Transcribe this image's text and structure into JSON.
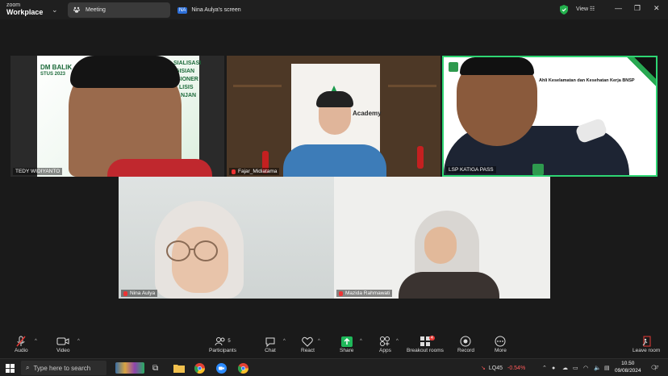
{
  "titlebar": {
    "brand_top": "zoom",
    "brand_bottom": "Workplace",
    "tab_meeting": "Meeting",
    "screen_initials": "NA",
    "tab_screen": "Nina Aulya's screen",
    "view_label": "View"
  },
  "participants": [
    {
      "name": "TEDY WIDIYANTO"
    },
    {
      "name": "Fajar_Midiatama"
    },
    {
      "name": "LSP KATIGA PASS"
    },
    {
      "name": "Nina Aulya"
    },
    {
      "name": "Mazida Rahmawati"
    }
  ],
  "tile_text": {
    "banner_left_1": "DM BALIK",
    "banner_left_2": "STUS 2023",
    "banner_right_1": "SIALISASI",
    "banner_right_2": "GISIAN",
    "banner_right_3": "SIONER",
    "banner_right_4": "LISIS",
    "banner_right_5": "NJAN",
    "academy_text": "Academy",
    "lsp_caption": "Ahli Keselamatan dan Kesehatan Kerja BNSP"
  },
  "toolbar": {
    "audio": "Audio",
    "video": "Video",
    "participants": "Participants",
    "participants_count": "5",
    "chat": "Chat",
    "react": "React",
    "share": "Share",
    "apps": "Apps",
    "breakout": "Breakout rooms",
    "breakout_badge": "4",
    "record": "Record",
    "more": "More",
    "leave": "Leave room"
  },
  "taskbar": {
    "search_placeholder": "Type here to search",
    "ticker": "LQ45",
    "ticker_change": "-0.54%",
    "time": "10.50",
    "date": "09/08/2024",
    "notif_count": "17"
  },
  "colors": {
    "active_speaker": "#2ed573",
    "share_green": "#1fb85a",
    "ticker_red": "#ff5a5a"
  }
}
